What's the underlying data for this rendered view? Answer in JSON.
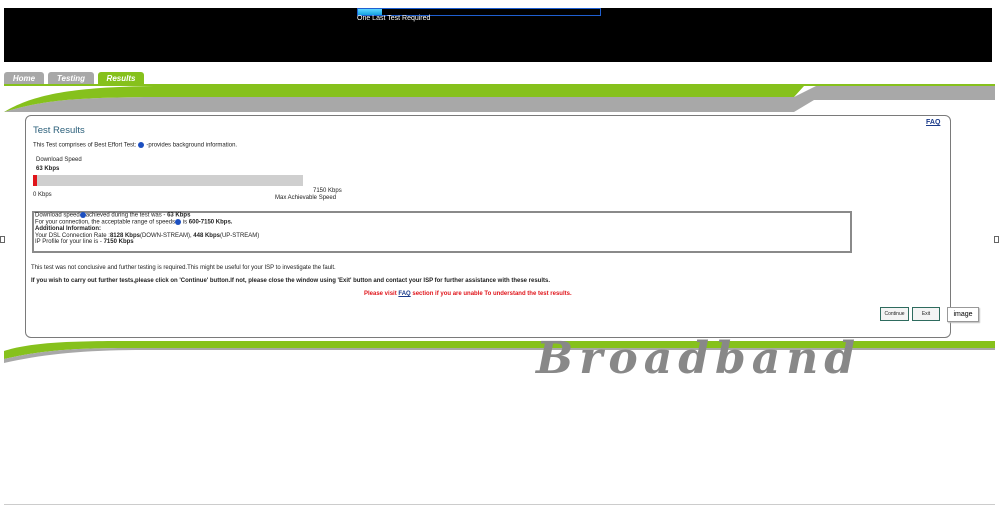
{
  "header": {
    "progress_fraction": 0.1,
    "progress_label": "One Last Test Required"
  },
  "tabs": [
    {
      "label": "Home"
    },
    {
      "label": "Testing"
    },
    {
      "label": "Results"
    }
  ],
  "card": {
    "title": "Test Results",
    "faq_label": "FAQ",
    "intro_before": "This Test comprises of Best Effort Test:",
    "intro_after": "-provides background information.",
    "speed_label": "Download  Speed",
    "speed_value": "63 Kbps",
    "speed_fraction": 0.0088,
    "min_label": "0 Kbps",
    "max_value": "7150 Kbps",
    "max_label": "Max Achievable Speed",
    "info": {
      "line1_pre": "Download speed",
      "line1_mid": "achieved during the test was - ",
      "line1_val": "63 Kbps",
      "line2_pre": "For your connection, the acceptable range of speeds",
      "line2_mid": " is ",
      "line2_val": "600-7150 Kbps.",
      "line3": "Additional Information:",
      "line4_pre": "Your DSL Connection Rate :",
      "line4_down": "8128 Kbps",
      "line4_mid": "(DOWN-STREAM), ",
      "line4_up": "448 Kbps",
      "line4_end": "(UP-STREAM)",
      "line5_pre": "IP Profile for your line is - ",
      "line5_val": "7150 Kbps"
    },
    "note": "This test was not conclusive and further testing is required.This might be useful for your ISP to investigate the fault.",
    "instruction": "If you wish to carry out further tests,please click on 'Continue' button.If not, please close the window using 'Exit' button and contact your ISP for further assistance with these results.",
    "faq_hint_pre": "Please visit ",
    "faq_hint_link": "FAQ",
    "faq_hint_post": " section if you are unable To understand the test results.",
    "continue_label": "Continue",
    "exit_label": "Exit"
  },
  "image_button_label": "image",
  "brand_word": "Broadband",
  "colors": {
    "green": "#86c11c",
    "grey": "#a8a8a8",
    "red": "#e0151b",
    "black": "#000000"
  }
}
